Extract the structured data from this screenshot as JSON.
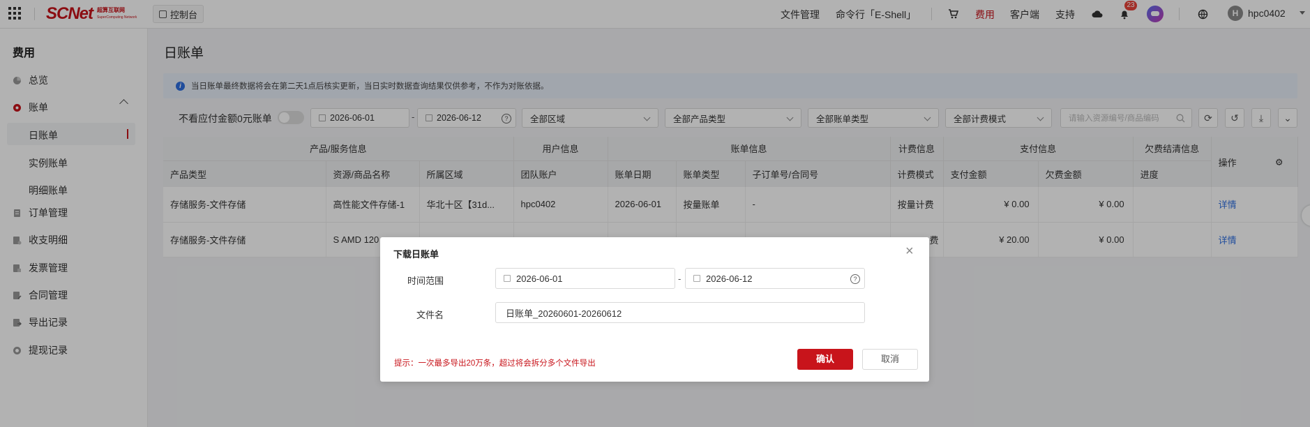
{
  "topbar": {
    "logo_main": "SCNet",
    "logo_sub_1": "超算互联网",
    "logo_sub_2": "SuperComputing Network",
    "console_label": "控制台",
    "nav": {
      "files": "文件管理",
      "shell": "命令行「E-Shell」",
      "billing": "费用",
      "client": "客户端",
      "support": "支持"
    },
    "notification_count": "23",
    "user_initial": "H",
    "user_name": "hpc0402"
  },
  "sidebar": {
    "title": "费用",
    "items": [
      {
        "label": "总览",
        "icon": "pie-chart-icon"
      },
      {
        "label": "账单",
        "icon": "bill-icon"
      },
      {
        "label": "订单管理",
        "icon": "order-icon"
      },
      {
        "label": "收支明细",
        "icon": "ledger-icon"
      },
      {
        "label": "发票管理",
        "icon": "invoice-icon"
      },
      {
        "label": "合同管理",
        "icon": "contract-icon"
      },
      {
        "label": "导出记录",
        "icon": "export-icon"
      },
      {
        "label": "提现记录",
        "icon": "withdraw-icon"
      }
    ],
    "subitems": [
      "日账单",
      "实例账单",
      "明细账单"
    ],
    "active_subitem": "日账单"
  },
  "main": {
    "title": "日账单",
    "info": "当日账单最终数据将会在第二天1点后核实更新，当日实时数据查询结果仅供参考，不作为对账依据。",
    "filters": {
      "hide_zero_label": "不看应付金额0元账单",
      "date_from": "2026-06-01",
      "date_to": "2026-06-12",
      "range_sep": "-",
      "region": "全部区域",
      "product_type": "全部产品类型",
      "bill_type": "全部账单类型",
      "billing_mode": "全部计费模式",
      "search_placeholder": "请输入资源编号/商品编码"
    },
    "table": {
      "groups": [
        "产品/服务信息",
        "用户信息",
        "账单信息",
        "计费信息",
        "支付信息",
        "欠费结清信息",
        "操作"
      ],
      "columns": [
        "产品类型",
        "资源/商品名称",
        "所属区域",
        "团队账户",
        "账单日期",
        "账单类型",
        "子订单号/合同号",
        "计费模式",
        "支付金额",
        "欠费金额",
        "进度"
      ],
      "rows": [
        {
          "product_type": "存储服务-文件存储",
          "resource": "高性能文件存储-1",
          "region": "华北十区【31d...",
          "account": "hpc0402",
          "date": "2026-06-01",
          "bill_type": "按量账单",
          "sub_order": "-",
          "mode": "按量计费",
          "paid": "¥ 0.00",
          "owed": "¥ 0.00",
          "progress": "",
          "action": "详情"
        },
        {
          "product_type": "存储服务-文件存储",
          "resource": "S AMD 120",
          "region": "",
          "account": "",
          "date": "",
          "bill_type": "",
          "sub_order": "",
          "mode": "费",
          "paid": "¥ 20.00",
          "owed": "¥ 0.00",
          "progress": "",
          "action": "详情"
        }
      ]
    }
  },
  "modal": {
    "title": "下载日账单",
    "time_label": "时间范围",
    "date_from": "2026-06-01",
    "date_to": "2026-06-12",
    "range_sep": "-",
    "filename_label": "文件名",
    "filename": "日账单_20260601-20260612",
    "tip": "提示：一次最多导出20万条，超过将会拆分多个文件导出",
    "confirm": "确认",
    "cancel": "取消"
  },
  "colors": {
    "brand": "#c8141b",
    "link": "#2f6fe0"
  }
}
